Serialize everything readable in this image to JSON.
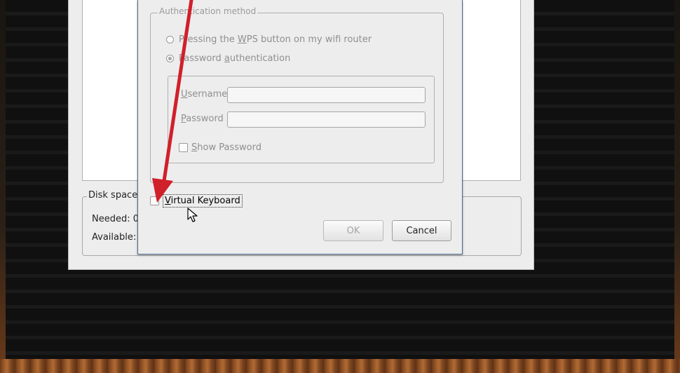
{
  "installer": {
    "disk_space": {
      "legend": "Disk space",
      "needed_label": "Needed: 0",
      "available_label": "Available:"
    }
  },
  "wifi_dialog": {
    "auth_method": {
      "legend": "Authentication method",
      "option_wps": {
        "pre": "Pressing the ",
        "mnemonic": "W",
        "post": "PS button on my wifi router",
        "selected": false
      },
      "option_password": {
        "pre": "Password ",
        "mnemonic": "a",
        "post": "uthentication",
        "selected": true
      }
    },
    "username": {
      "mnemonic": "U",
      "rest": "sername",
      "value": ""
    },
    "password": {
      "mnemonic": "P",
      "rest": "assword",
      "value": ""
    },
    "show_password": {
      "mnemonic": "S",
      "rest": "how Password",
      "checked": false
    },
    "virtual_keyboard": {
      "mnemonic": "V",
      "rest": "irtual Keyboard",
      "checked": false
    },
    "buttons": {
      "ok": "OK",
      "cancel": "Cancel"
    }
  },
  "annotation": {
    "color": "#d0202a",
    "icon": "red-arrow-annotation"
  },
  "cursor": {
    "icon": "mouse-pointer-icon"
  }
}
